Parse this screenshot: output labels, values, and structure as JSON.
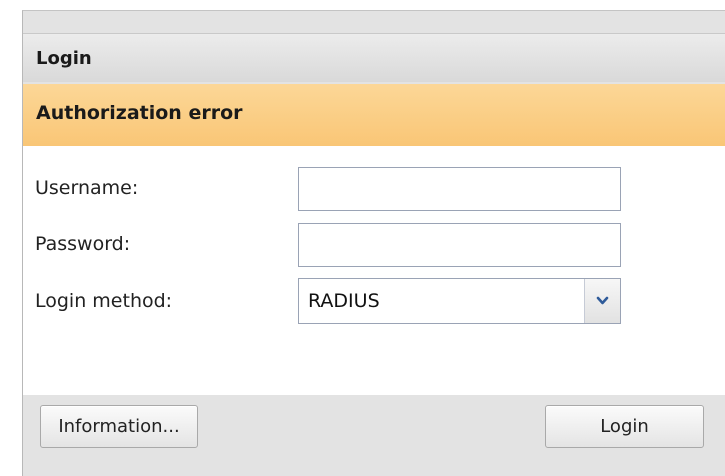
{
  "dialog": {
    "title": "Login",
    "error_message": "Authorization error"
  },
  "form": {
    "username": {
      "label": "Username:",
      "value": ""
    },
    "password": {
      "label": "Password:",
      "value": ""
    },
    "login_method": {
      "label": "Login method:",
      "selected": "RADIUS"
    }
  },
  "buttons": {
    "information": "Information...",
    "login": "Login"
  },
  "icons": {
    "dropdown": "chevron-down-icon"
  },
  "colors": {
    "error_banner": "#f9c676",
    "chevron": "#2f5b9a"
  }
}
